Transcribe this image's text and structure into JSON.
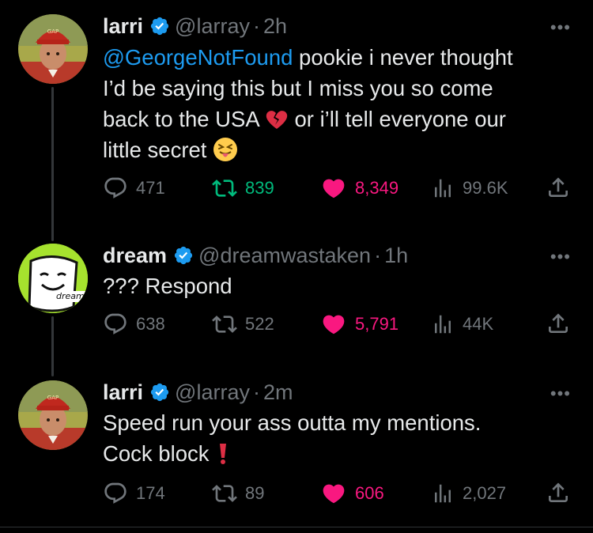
{
  "tweets": [
    {
      "name": "larri",
      "handle": "@larray",
      "dot": "·",
      "time": "2h",
      "more": "•••",
      "mention": "@GeorgeNotFound",
      "line1_rest": " pookie i never thought",
      "line2": "I’d be saying this but I miss you so come",
      "line3a": "back to the USA ",
      "line3b": " or i’ll tell everyone our",
      "line4": "little secret ",
      "replies": "471",
      "retweets": "839",
      "likes": "8,349",
      "views": "99.6K",
      "avatar_icon": "profile-photo",
      "emoji_1": "broken-heart-icon",
      "emoji_2": "squinting-face-with-tongue-icon"
    },
    {
      "name": "dream",
      "handle": "@dreamwastaken",
      "dot": "·",
      "time": "1h",
      "more": "•••",
      "text": "??? Respond",
      "avatar_label": "dream",
      "replies": "638",
      "retweets": "522",
      "likes": "5,791",
      "views": "44K"
    },
    {
      "name": "larri",
      "handle": "@larray",
      "dot": "·",
      "time": "2m",
      "more": "•••",
      "line1": "Speed run your ass outta my mentions.",
      "line2": "Cock block ",
      "emoji_1": "red-exclamation-icon",
      "replies": "174",
      "retweets": "89",
      "likes": "606",
      "views": "2,027"
    }
  ],
  "colors": {
    "background": "#000000",
    "text": "#e7e9ea",
    "muted": "#71767b",
    "link": "#1d9bf0",
    "retweet": "#00ba7c",
    "like": "#f91880",
    "verified": "#1d9bf0",
    "dream_green": "#a6e22e"
  }
}
